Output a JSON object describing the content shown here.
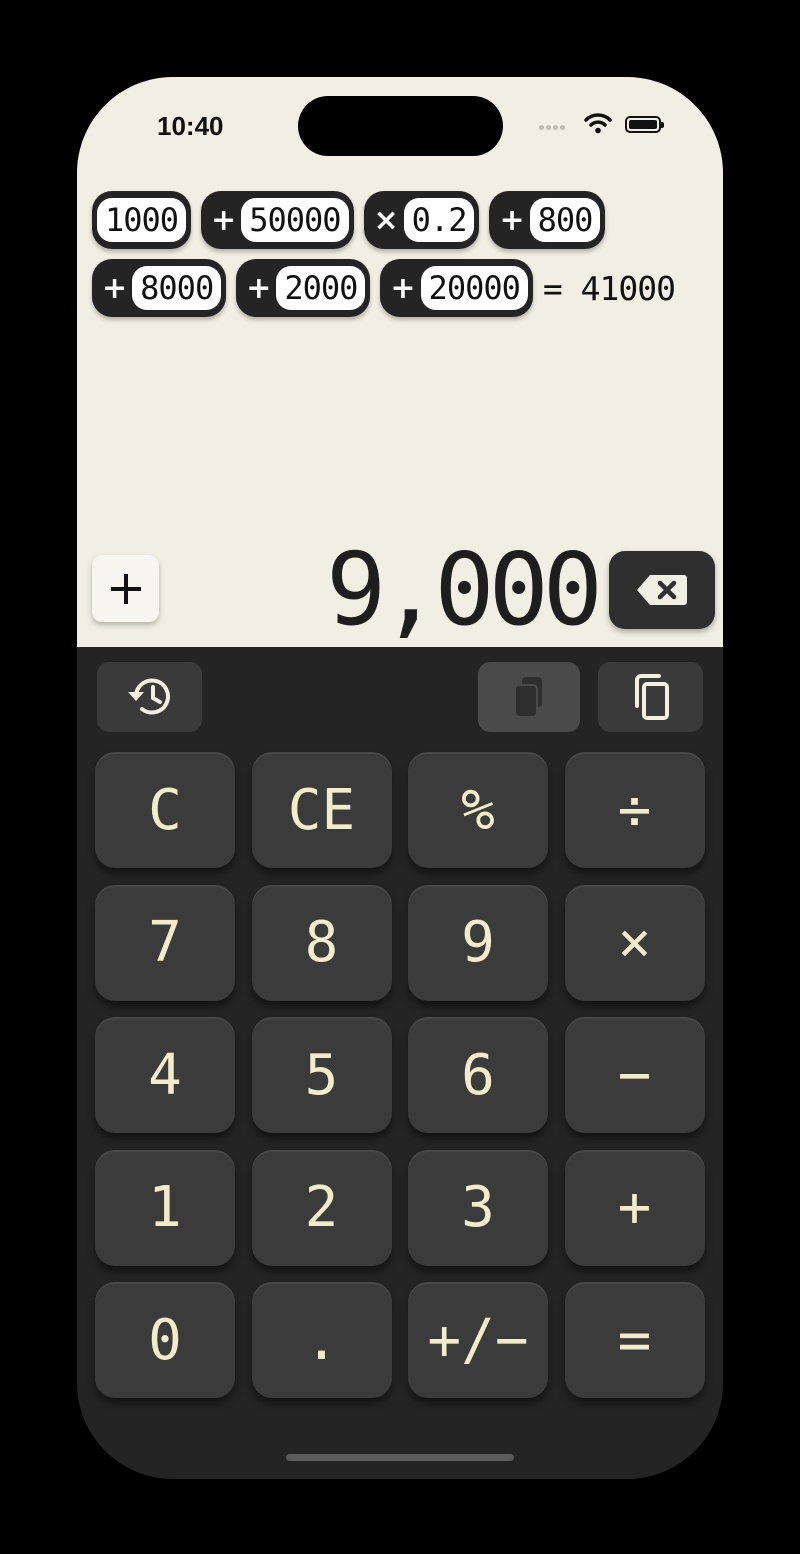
{
  "status": {
    "time": "10:40"
  },
  "tape": {
    "row1": [
      {
        "op": "",
        "value": "1000"
      },
      {
        "op": "+",
        "value": "50000"
      },
      {
        "op": "×",
        "value": "0.2"
      },
      {
        "op": "+",
        "value": "800"
      }
    ],
    "row2": [
      {
        "op": "+",
        "value": "8000"
      },
      {
        "op": "+",
        "value": "2000"
      },
      {
        "op": "+",
        "value": "20000"
      }
    ],
    "result": "= 41000"
  },
  "display": {
    "value": "9,000",
    "plus_label": "+"
  },
  "keys": [
    [
      "C",
      "CE",
      "%",
      "÷"
    ],
    [
      "7",
      "8",
      "9",
      "×"
    ],
    [
      "4",
      "5",
      "6",
      "−"
    ],
    [
      "1",
      "2",
      "3",
      "+"
    ],
    [
      "0",
      ".",
      "+/−",
      "="
    ]
  ],
  "icons": {
    "history": "history-icon",
    "paste": "paste-icon",
    "copy": "copy-icon",
    "backspace": "backspace-icon"
  },
  "colors": {
    "display_bg": "#f1efe3",
    "keypad_bg": "#242424",
    "key_bg": "#3b3b3b",
    "key_text": "#f3ecca"
  }
}
